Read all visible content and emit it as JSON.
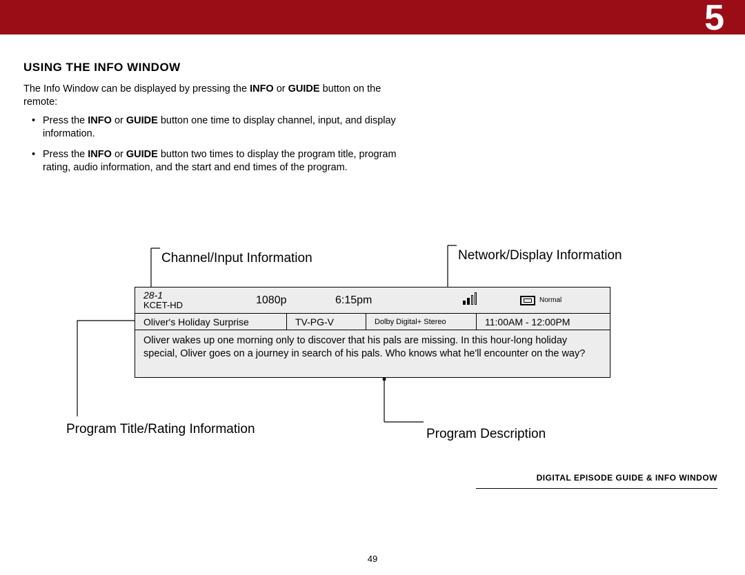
{
  "chapter": "5",
  "heading": "USING THE INFO WINDOW",
  "intro_pre": "The Info Window can be displayed by pressing the ",
  "intro_b1": "INFO",
  "intro_mid": " or ",
  "intro_b2": "GUIDE",
  "intro_post": " button on the remote:",
  "bullet1_pre": "Press the ",
  "bullet1_b1": "INFO",
  "bullet1_mid": " or ",
  "bullet1_b2": "GUIDE",
  "bullet1_post": " button one time to display channel, input, and display information.",
  "bullet2_pre": "Press the ",
  "bullet2_b1": "INFO",
  "bullet2_mid": " or ",
  "bullet2_b2": "GUIDE",
  "bullet2_post": " button two times to display the program title, program rating, audio information, and the start and end times of the program.",
  "callouts": {
    "channel": "Channel/Input Information",
    "network": "Network/Display Information",
    "title": "Program Title/Rating Information",
    "desc": "Program Description"
  },
  "info": {
    "channel_num": "28-1",
    "channel_name": "KCET-HD",
    "resolution": "1080p",
    "time": "6:15pm",
    "display_mode": "Normal",
    "program_title": "Oliver's Holiday Surprise",
    "rating": "TV-PG-V",
    "audio": "Dolby Digital+ Stereo",
    "schedule": "11:00AM - 12:00PM",
    "description": "Oliver wakes up one morning only to discover that his pals are missing. In this hour-long holiday special, Oliver goes on a journey in search of his pals. Who knows what he'll encounter on the way?"
  },
  "footer_tag": "DIGITAL EPISODE GUIDE & INFO WINDOW",
  "page_number": "49"
}
